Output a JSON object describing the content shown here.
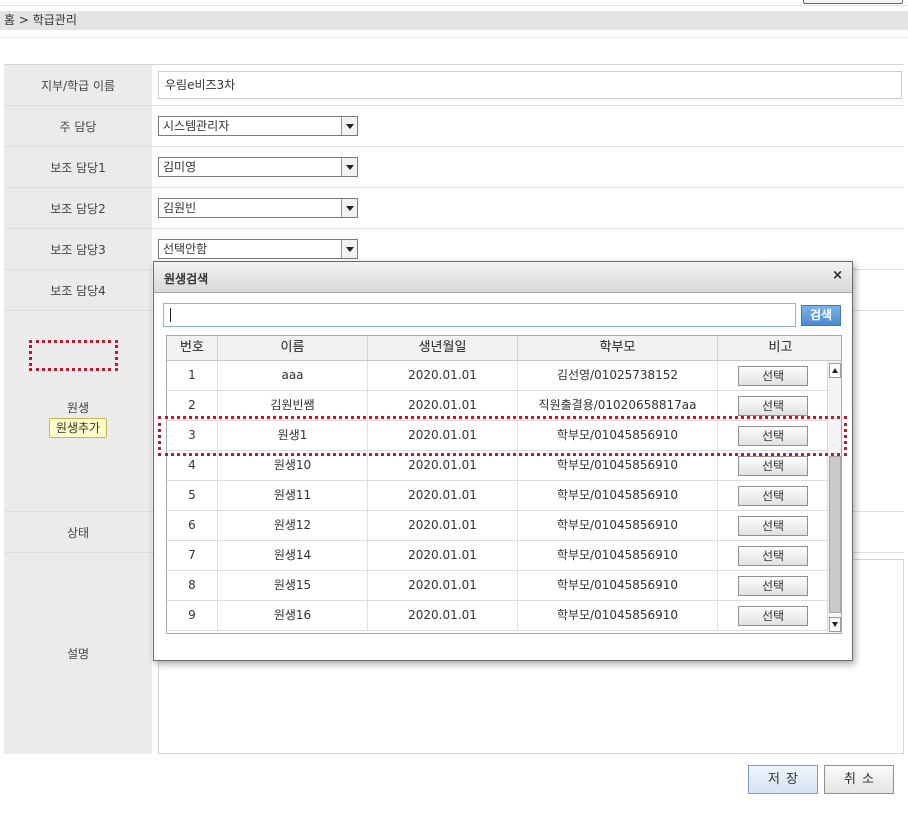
{
  "breadcrumb": "홈 > 학급관리",
  "form": {
    "class_name_label": "지부/학급 이름",
    "class_name_value": "우림e비즈3차",
    "main_manager_label": "주 담당",
    "main_manager_value": "시스템관리자",
    "assistant1_label": "보조 담당1",
    "assistant1_value": "김미영",
    "assistant2_label": "보조 담당2",
    "assistant2_value": "김원빈",
    "assistant3_label": "보조 담당3",
    "assistant3_value": "선택안함",
    "assistant4_label": "보조 담당4",
    "student_label": "원생",
    "add_student_label": "원생추가",
    "status_label": "상태",
    "description_label": "설명"
  },
  "actions": {
    "save_label": "저장",
    "cancel_label": "취소"
  },
  "modal": {
    "title": "원생검색",
    "close_glyph": "×",
    "search_value": "",
    "search_button_label": "검색",
    "columns": [
      "번호",
      "이름",
      "생년월일",
      "학부모",
      "비고"
    ],
    "select_label": "선택",
    "rows": [
      {
        "no": "1",
        "name": "aaa",
        "birth": "2020.01.01",
        "parent": "김선영/01025738152"
      },
      {
        "no": "2",
        "name": "김원빈쌤",
        "birth": "2020.01.01",
        "parent": "직원출결용/01020658817aa"
      },
      {
        "no": "3",
        "name": "원생1",
        "birth": "2020.01.01",
        "parent": "학부모/01045856910"
      },
      {
        "no": "4",
        "name": "원생10",
        "birth": "2020.01.01",
        "parent": "학부모/01045856910"
      },
      {
        "no": "5",
        "name": "원생11",
        "birth": "2020.01.01",
        "parent": "학부모/01045856910"
      },
      {
        "no": "6",
        "name": "원생12",
        "birth": "2020.01.01",
        "parent": "학부모/01045856910"
      },
      {
        "no": "7",
        "name": "원생14",
        "birth": "2020.01.01",
        "parent": "학부모/01045856910"
      },
      {
        "no": "8",
        "name": "원생15",
        "birth": "2020.01.01",
        "parent": "학부모/01045856910"
      },
      {
        "no": "9",
        "name": "원생16",
        "birth": "2020.01.01",
        "parent": "학부모/01045856910"
      }
    ]
  },
  "colors": {
    "highlight": "#c0192b",
    "search_button": "#4a89d2",
    "add_button_bg": "#fffcc7",
    "label_bg": "#ebebeb"
  }
}
